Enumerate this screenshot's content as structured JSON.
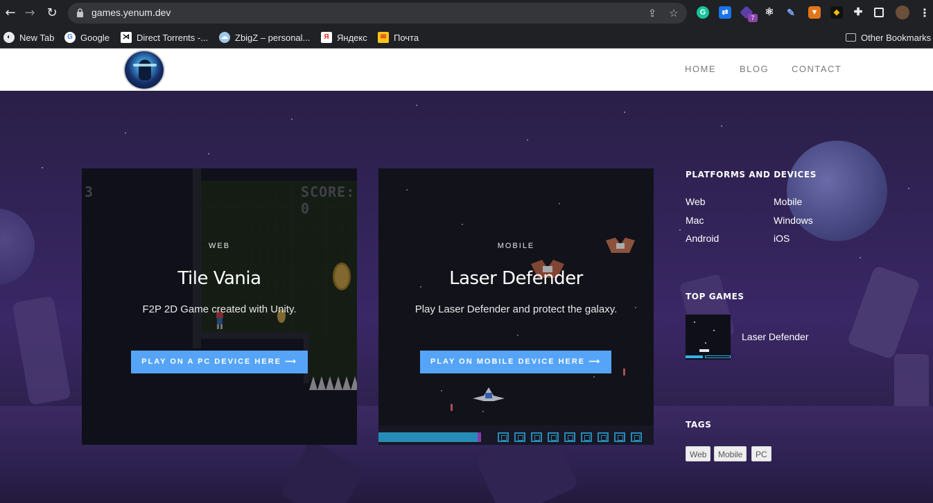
{
  "browser": {
    "url": "games.yenum.dev",
    "extension_badge": "7",
    "bookmarks": [
      {
        "label": "New Tab",
        "icon": "globe-icon"
      },
      {
        "label": "Google",
        "icon": "google-icon"
      },
      {
        "label": "Direct Torrents -...",
        "icon": "torrent-icon"
      },
      {
        "label": "ZbigZ – personal...",
        "icon": "cloud-icon"
      },
      {
        "label": "Яндекс",
        "icon": "yandex-icon"
      },
      {
        "label": "Почта",
        "icon": "mail-icon"
      }
    ],
    "other_bookmarks": "Other Bookmarks"
  },
  "site": {
    "nav": [
      "HOME",
      "BLOG",
      "CONTACT"
    ]
  },
  "games": [
    {
      "tag": "WEB",
      "title": "Tile Vania",
      "description": "F2P 2D Game created with Unity.",
      "button": "PLAY ON A PC DEVICE HERE ⟶",
      "art": {
        "score_text": "SCORE: 0",
        "lives_text": "3"
      }
    },
    {
      "tag": "MOBILE",
      "title": "Laser Defender",
      "description": "Play Laser Defender and protect the galaxy.",
      "button": "PLAY ON MOBILE DEVICE HERE ⟶"
    }
  ],
  "sidebar": {
    "platforms_heading": "PLATFORMS AND DEVICES",
    "platforms": [
      "Web",
      "Mobile",
      "Mac",
      "Windows",
      "Android",
      "iOS"
    ],
    "top_games_heading": "TOP GAMES",
    "top_games": [
      "Laser Defender"
    ],
    "tags_heading": "TAGS",
    "tags": [
      "Web",
      "Mobile",
      "PC"
    ]
  },
  "colors": {
    "button_blue": "#55a4f7",
    "hero_purple": "#33245a",
    "chrome_bg": "#202124"
  }
}
